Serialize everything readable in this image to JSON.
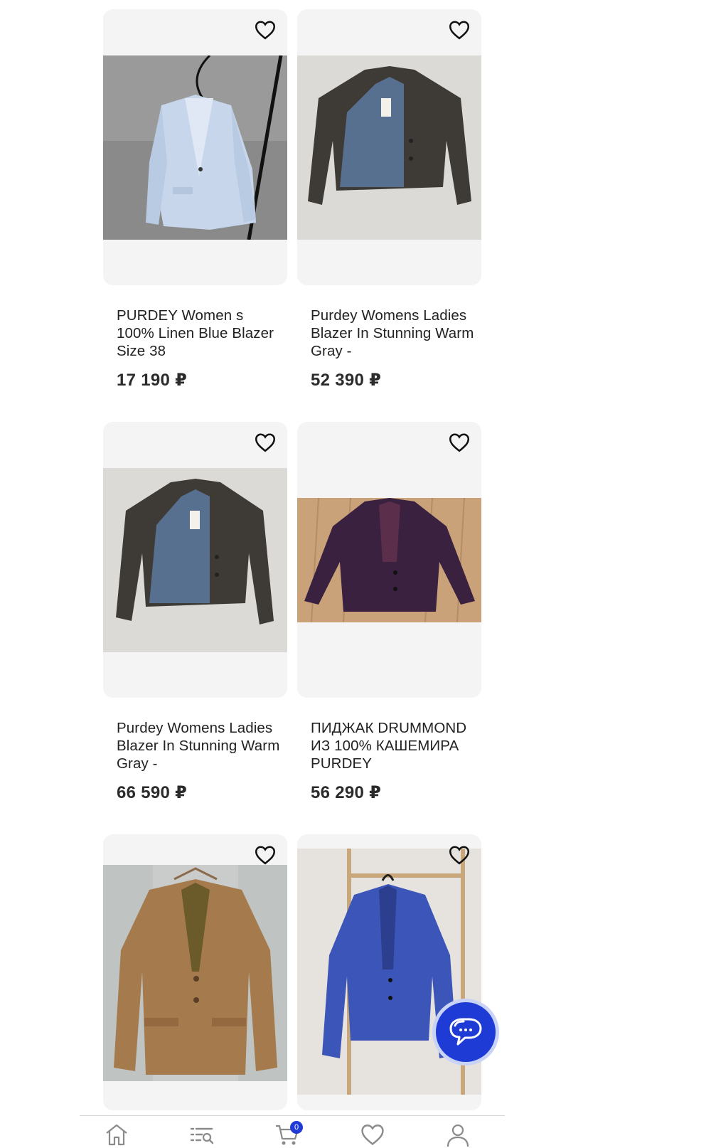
{
  "products": [
    {
      "title": "PURDEY Women s 100% Linen Blue Blazer Size 38",
      "price": "17 190 ₽",
      "favorite_icon": "heart-icon"
    },
    {
      "title": "Purdey Womens Ladies Blazer In Stunning Warm Gray -",
      "price": "52 390 ₽",
      "favorite_icon": "heart-icon"
    },
    {
      "title": "Purdey Womens Ladies Blazer In Stunning Warm Gray -",
      "price": "66 590 ₽",
      "favorite_icon": "heart-icon"
    },
    {
      "title": "ПИДЖАК DRUMMOND ИЗ 100% КАШЕМИРА PURDEY",
      "price": "56 290 ₽",
      "favorite_icon": "heart-icon"
    },
    {
      "title": "",
      "price": "",
      "favorite_icon": "heart-icon"
    },
    {
      "title": "",
      "price": "",
      "favorite_icon": "heart-icon"
    }
  ],
  "chat_button": {
    "icon": "chat-bubble-icon"
  },
  "bottom_nav": {
    "items": [
      {
        "icon": "home-icon"
      },
      {
        "icon": "catalog-search-icon"
      },
      {
        "icon": "cart-icon",
        "badge": "0"
      },
      {
        "icon": "heart-icon"
      },
      {
        "icon": "user-icon"
      }
    ]
  },
  "colors": {
    "accent": "#1f3bd6",
    "card_bg": "#f4f4f4",
    "price": "#2b2b2b"
  }
}
